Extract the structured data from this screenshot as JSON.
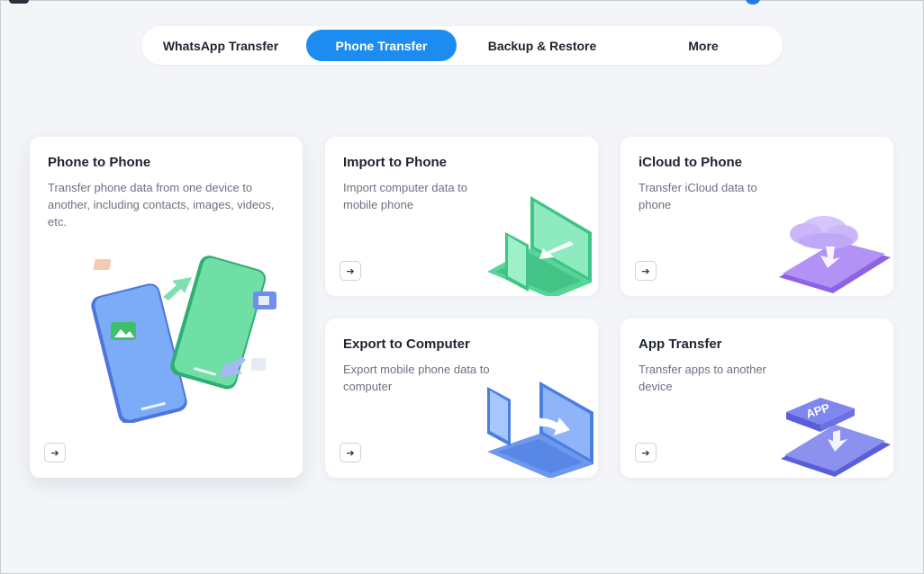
{
  "tabs": [
    {
      "label": "WhatsApp Transfer",
      "active": false
    },
    {
      "label": "Phone Transfer",
      "active": true
    },
    {
      "label": "Backup & Restore",
      "active": false
    },
    {
      "label": "More",
      "active": false
    }
  ],
  "cards": {
    "phone_to_phone": {
      "title": "Phone to Phone",
      "desc": "Transfer phone data from one device to another, including contacts, images, videos, etc.",
      "icon": "arrow-right-icon"
    },
    "import_to_phone": {
      "title": "Import to Phone",
      "desc": "Import computer data to mobile phone",
      "icon": "arrow-right-icon"
    },
    "icloud_to_phone": {
      "title": "iCloud to Phone",
      "desc": "Transfer iCloud data to phone",
      "icon": "arrow-right-icon"
    },
    "export_to_computer": {
      "title": "Export to Computer",
      "desc": "Export mobile phone data to computer",
      "icon": "arrow-right-icon"
    },
    "app_transfer": {
      "title": "App Transfer",
      "desc": "Transfer apps to another device",
      "icon": "arrow-right-icon",
      "badge": "APP"
    }
  },
  "colors": {
    "accent": "#1c8cf0",
    "background": "#f3f5f9",
    "green": "#3ecf8e",
    "blue": "#5b8df5",
    "purple": "#9a7cf0"
  }
}
